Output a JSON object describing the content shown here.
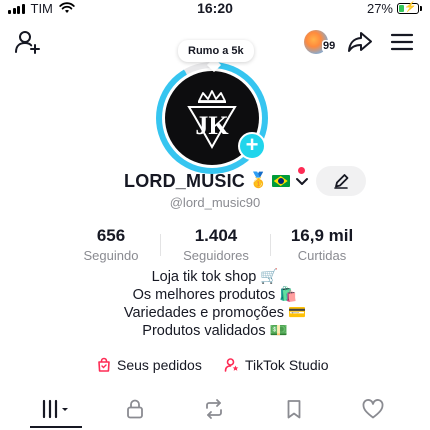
{
  "status_bar": {
    "carrier": "TIM",
    "time": "16:20",
    "battery_percent": "27%",
    "battery_level": 0.27,
    "battery_color": "#34c759"
  },
  "header": {
    "add_friend_icon": "add-user-icon",
    "notification_count": "99",
    "share_icon": "share-arrow-icon",
    "menu_icon": "hamburger-menu-icon"
  },
  "avatar": {
    "bubble_text": "Rumo a 5k",
    "ring_color": "#36c5f0",
    "logo_text": "JK",
    "add_color": "#20d5ec"
  },
  "profile": {
    "display_name": "LORD_MUSIC",
    "badge_medal": "🥇",
    "username": "@lord_music90",
    "edit_icon": "pencil-icon"
  },
  "stats": [
    {
      "value": "656",
      "label": "Seguindo"
    },
    {
      "value": "1.404",
      "label": "Seguidores"
    },
    {
      "value": "16,9 mil",
      "label": "Curtidas"
    }
  ],
  "bio": [
    "Loja tik tok shop 🛒",
    "Os melhores produtos 🛍️",
    "Variedades e promoções 💳",
    "Produtos validados 💵"
  ],
  "links": {
    "orders": "Seus pedidos",
    "studio": "TikTok Studio"
  },
  "tabs": [
    {
      "name": "videos-grid",
      "icon": "grid-bars-icon",
      "active": true
    },
    {
      "name": "private",
      "icon": "lock-icon"
    },
    {
      "name": "reposts",
      "icon": "repost-icon"
    },
    {
      "name": "favorites",
      "icon": "bookmark-icon"
    },
    {
      "name": "liked",
      "icon": "heart-icon"
    }
  ],
  "colors": {
    "accent_red": "#fe2c55",
    "text_primary": "#161823",
    "text_secondary": "#8a8b91"
  }
}
